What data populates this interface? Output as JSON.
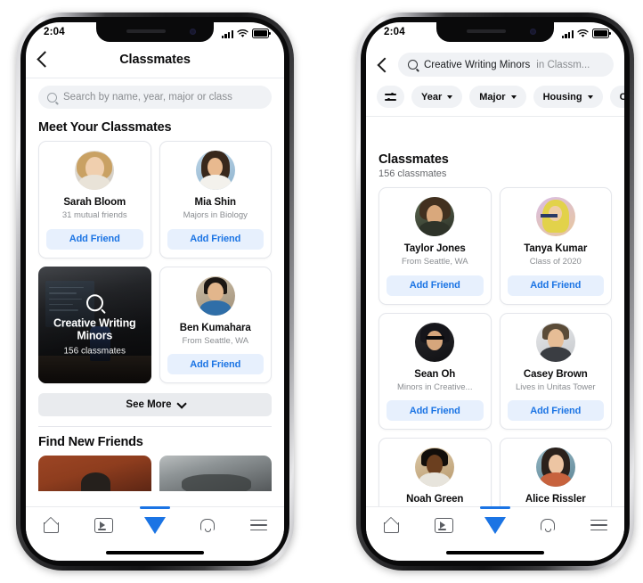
{
  "colors": {
    "accent_blue": "#1b74e4",
    "add_friend_bg": "#e7f0fd",
    "chip_bg": "#f0f2f5",
    "see_more_bg": "#e9ebee",
    "text_primary": "#0c0c0d",
    "text_secondary": "#8a8d91"
  },
  "left_phone": {
    "status": {
      "time": "2:04",
      "signal_icon": "cellular-bars-icon",
      "wifi_icon": "wifi-icon",
      "battery_icon": "battery-full-icon"
    },
    "nav": {
      "back_icon": "chevron-left-icon",
      "title": "Classmates"
    },
    "search": {
      "icon": "search-icon",
      "placeholder": "Search by name, year, major or class",
      "value": ""
    },
    "section_title": "Meet Your Classmates",
    "cards": [
      {
        "type": "person",
        "name": "Sarah Bloom",
        "meta": "31 mutual friends",
        "action": "Add Friend",
        "avatar": "avatar-sarah-bloom"
      },
      {
        "type": "person",
        "name": "Mia Shin",
        "meta": "Majors in Biology",
        "action": "Add Friend",
        "avatar": "avatar-mia-shin"
      },
      {
        "type": "tile",
        "title": "Creative Writing Minors",
        "title_line1": "Creative Writing",
        "title_line2": "Minors",
        "subtitle": "156 classmates",
        "icon": "search-icon"
      },
      {
        "type": "person",
        "name": "Ben Kumahara",
        "meta": "From Seattle, WA",
        "action": "Add Friend",
        "avatar": "avatar-ben-kumahara"
      }
    ],
    "see_more": {
      "label": "See More",
      "icon": "chevron-down-icon"
    },
    "find_new_friends": {
      "title": "Find New Friends",
      "thumbs": [
        "thumbnail-red",
        "thumbnail-gray"
      ]
    },
    "tabbar": [
      {
        "name": "home",
        "icon": "home-icon",
        "active": false
      },
      {
        "name": "watch",
        "icon": "video-play-icon",
        "active": false
      },
      {
        "name": "marketplace",
        "icon": "triangle-flag-icon",
        "active": true
      },
      {
        "name": "notifications",
        "icon": "bell-icon",
        "active": false
      },
      {
        "name": "menu",
        "icon": "hamburger-menu-icon",
        "active": false
      }
    ]
  },
  "right_phone": {
    "status": {
      "time": "2:04",
      "signal_icon": "cellular-bars-icon",
      "wifi_icon": "wifi-icon",
      "battery_icon": "battery-full-icon"
    },
    "search": {
      "back_icon": "chevron-left-icon",
      "icon": "search-icon",
      "query": "Creative Writing Minors",
      "scope": " in Classm..."
    },
    "filters": [
      {
        "label": "",
        "icon": "filter-sliders-icon"
      },
      {
        "label": "Year",
        "icon": "caret-down-icon"
      },
      {
        "label": "Major",
        "icon": "caret-down-icon"
      },
      {
        "label": "Housing",
        "icon": "caret-down-icon"
      },
      {
        "label": "C",
        "icon": "caret-down-icon"
      }
    ],
    "results_title": "Classmates",
    "results_count": "156 classmates",
    "cards": [
      {
        "name": "Taylor Jones",
        "meta": "From Seattle, WA",
        "action": "Add Friend",
        "avatar": "avatar-taylor-jones"
      },
      {
        "name": "Tanya Kumar",
        "meta": "Class of 2020",
        "action": "Add Friend",
        "avatar": "avatar-tanya-kumar"
      },
      {
        "name": "Sean Oh",
        "meta": "Minors in Creative...",
        "action": "Add Friend",
        "avatar": "avatar-sean-oh"
      },
      {
        "name": "Casey Brown",
        "meta": "Lives in Unitas Tower",
        "action": "Add Friend",
        "avatar": "avatar-casey-brown"
      },
      {
        "name": "Noah Green",
        "meta": "",
        "action": "",
        "avatar": "avatar-noah-green"
      },
      {
        "name": "Alice Rissler",
        "meta": "",
        "action": "",
        "avatar": "avatar-alice-rissler"
      }
    ],
    "tabbar": [
      {
        "name": "home",
        "icon": "home-icon",
        "active": false
      },
      {
        "name": "watch",
        "icon": "video-play-icon",
        "active": false
      },
      {
        "name": "marketplace",
        "icon": "triangle-flag-icon",
        "active": true
      },
      {
        "name": "notifications",
        "icon": "bell-icon",
        "active": false
      },
      {
        "name": "menu",
        "icon": "hamburger-menu-icon",
        "active": false
      }
    ]
  }
}
